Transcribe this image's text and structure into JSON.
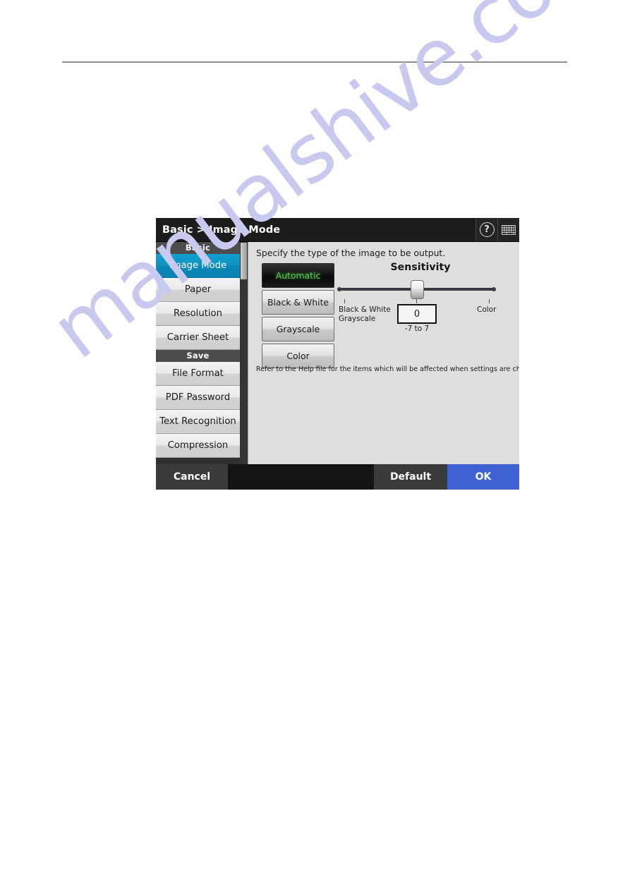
{
  "page": {
    "watermark": "manualshive.com",
    "watermark_color": "#c8c9ef",
    "rule_color": "#8b8b8e"
  },
  "dialog": {
    "titlebar": {
      "breadcrumb": "Basic > Image Mode",
      "help_icon_glyph": "?",
      "icons": [
        {
          "name": "help-icon",
          "label": "?"
        },
        {
          "name": "keyboard-icon",
          "label": "keyboard"
        }
      ]
    },
    "sidebar": {
      "groups": [
        {
          "header": "Basic",
          "items": [
            {
              "label": "Image Mode",
              "selected": true
            },
            {
              "label": "Paper",
              "selected": false
            },
            {
              "label": "Resolution",
              "selected": false
            },
            {
              "label": "Carrier Sheet",
              "selected": false
            }
          ]
        },
        {
          "header": "Save",
          "items": [
            {
              "label": "File Format",
              "selected": false
            },
            {
              "label": "PDF Password",
              "selected": false
            },
            {
              "label": "Text Recognition",
              "selected": false
            },
            {
              "label": "Compression",
              "selected": false
            }
          ]
        }
      ],
      "selected_color": "#0e92c2",
      "group_header_color": "#4d4d4d"
    },
    "content": {
      "description": "Specify the type of the image to be output.",
      "modes": [
        {
          "label": "Automatic",
          "active": true
        },
        {
          "label": "Black & White",
          "active": false
        },
        {
          "label": "Grayscale",
          "active": false
        },
        {
          "label": "Color",
          "active": false
        }
      ],
      "active_mode_text_color": "#55cc55",
      "sensitivity": {
        "title": "Sensitivity",
        "value": "0",
        "range_label": "-7 to 7",
        "scale_left_line1": "Black & White",
        "scale_left_line2": "Grayscale",
        "scale_right": "Color",
        "slider_min": -7,
        "slider_max": 7,
        "slider_position_percent": 50
      },
      "help_note": "Refer to the Help file for the items which will be affected when settings are changed."
    },
    "footer": {
      "cancel_label": "Cancel",
      "default_label": "Default",
      "ok_label": "OK",
      "ok_color": "#3f62d2"
    }
  }
}
